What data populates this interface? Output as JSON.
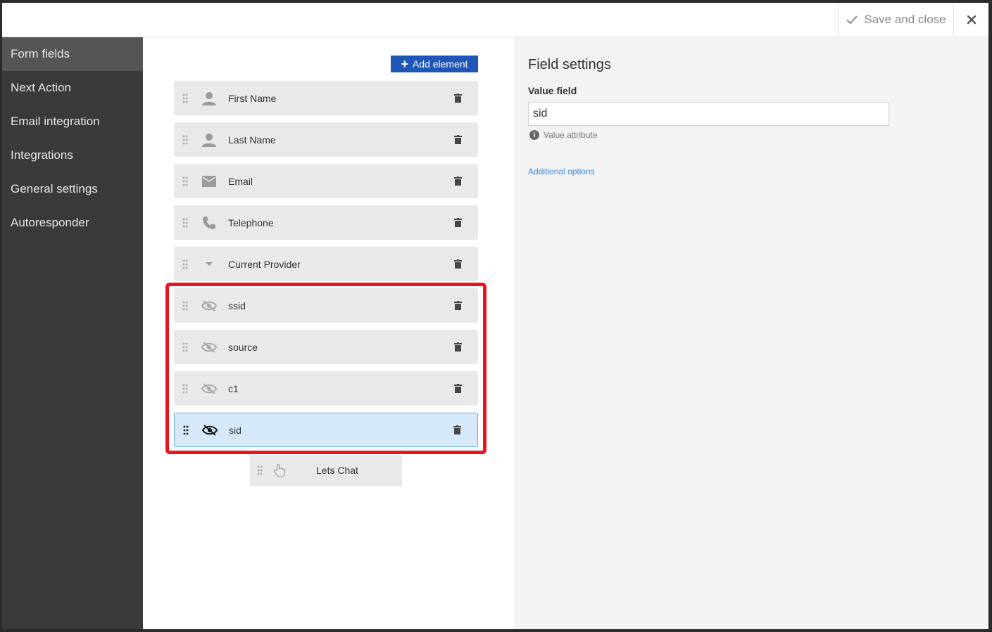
{
  "topbar": {
    "save_label": "Save and close",
    "close_glyph": "✕"
  },
  "sidebar": {
    "items": [
      {
        "label": "Form fields",
        "active": true
      },
      {
        "label": "Next Action",
        "active": false
      },
      {
        "label": "Email integration",
        "active": false
      },
      {
        "label": "Integrations",
        "active": false
      },
      {
        "label": "General settings",
        "active": false
      },
      {
        "label": "Autoresponder",
        "active": false
      }
    ]
  },
  "center": {
    "add_button_label": "Add element",
    "fields": [
      {
        "label": "First Name",
        "icon": "person-icon"
      },
      {
        "label": "Last Name",
        "icon": "person-icon"
      },
      {
        "label": "Email",
        "icon": "envelope-icon"
      },
      {
        "label": "Telephone",
        "icon": "phone-icon"
      },
      {
        "label": "Current Provider",
        "icon": "dropdown-arrow-icon"
      },
      {
        "label": "ssid",
        "icon": "eye-off-icon"
      },
      {
        "label": "source",
        "icon": "eye-off-icon"
      },
      {
        "label": "c1",
        "icon": "eye-off-icon"
      },
      {
        "label": "sid",
        "icon": "eye-off-icon",
        "selected": true
      }
    ],
    "submit_button": {
      "label": "Lets Chat",
      "icon": "hand-pointer-icon"
    }
  },
  "settings": {
    "title": "Field settings",
    "value_field_label": "Value field",
    "value_field_value": "sid",
    "hint": "Value attribute",
    "additional_options": "Additional options"
  },
  "colors": {
    "accent": "#1f57b8",
    "highlight": "#e8141e",
    "selected_row": "#d5e9fb",
    "sidebar": "#3a3a3a"
  }
}
